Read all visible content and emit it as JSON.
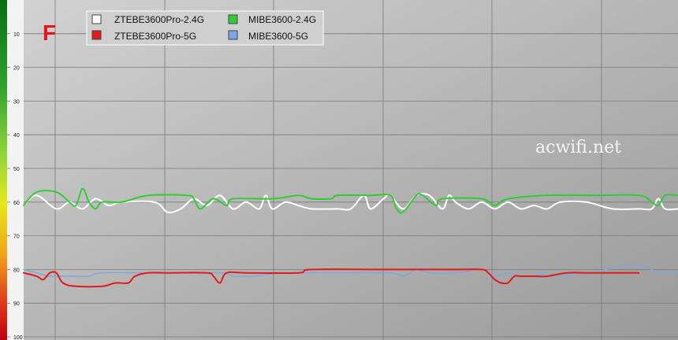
{
  "chart_data": {
    "type": "line",
    "grade_label": "F",
    "watermark": "acwifi.net",
    "y_axis": {
      "min": 0,
      "max": 100,
      "inverted": true,
      "ticks": [
        10,
        20,
        30,
        40,
        50,
        60,
        70,
        80,
        90,
        100
      ],
      "tick_labels": [
        "10",
        "20",
        "30",
        "40",
        "50",
        "60",
        "70",
        "80",
        "90",
        "100"
      ]
    },
    "x_axis": {
      "min": 0,
      "max": 100
    },
    "grid": true,
    "legend_position": "top-left",
    "series": [
      {
        "name": "ZTEBE3600Pro-2.4G",
        "color": "#ffffff",
        "points": [
          [
            0,
            61
          ],
          [
            2,
            58
          ],
          [
            5,
            62
          ],
          [
            7,
            60
          ],
          [
            9,
            62
          ],
          [
            11,
            59
          ],
          [
            13,
            61
          ],
          [
            15,
            60
          ],
          [
            20,
            60
          ],
          [
            22,
            63
          ],
          [
            24,
            62
          ],
          [
            26,
            59
          ],
          [
            28,
            61
          ],
          [
            30,
            58
          ],
          [
            32,
            62
          ],
          [
            34,
            60
          ],
          [
            36,
            62
          ],
          [
            37,
            58
          ],
          [
            38,
            62
          ],
          [
            40,
            60
          ],
          [
            42,
            61
          ],
          [
            44,
            62
          ],
          [
            48,
            62
          ],
          [
            50,
            62
          ],
          [
            52,
            58
          ],
          [
            53,
            62
          ],
          [
            55,
            59
          ],
          [
            56,
            58
          ],
          [
            58,
            62
          ],
          [
            60,
            58
          ],
          [
            62,
            58
          ],
          [
            64,
            62
          ],
          [
            65,
            58
          ],
          [
            66,
            60
          ],
          [
            68,
            62
          ],
          [
            70,
            60
          ],
          [
            72,
            62
          ],
          [
            74,
            60
          ],
          [
            76,
            62
          ],
          [
            78,
            61
          ],
          [
            80,
            62
          ],
          [
            82,
            60
          ],
          [
            86,
            60
          ],
          [
            90,
            62
          ],
          [
            94,
            62
          ],
          [
            96,
            62
          ],
          [
            97,
            59
          ],
          [
            98,
            62
          ],
          [
            100,
            62
          ]
        ]
      },
      {
        "name": "MIBE3600-2.4G",
        "color": "#33cc33",
        "points": [
          [
            0,
            61
          ],
          [
            2,
            57
          ],
          [
            5,
            57
          ],
          [
            7,
            60
          ],
          [
            8,
            61
          ],
          [
            9,
            56
          ],
          [
            10,
            60
          ],
          [
            11,
            62
          ],
          [
            12,
            60
          ],
          [
            15,
            60
          ],
          [
            19,
            58
          ],
          [
            25,
            58
          ],
          [
            26,
            59
          ],
          [
            27,
            62
          ],
          [
            29,
            59
          ],
          [
            31,
            61
          ],
          [
            32,
            59
          ],
          [
            38,
            59
          ],
          [
            42,
            58
          ],
          [
            44,
            59
          ],
          [
            47,
            59
          ],
          [
            48,
            58
          ],
          [
            53,
            58
          ],
          [
            56,
            58
          ],
          [
            57,
            62
          ],
          [
            58,
            63
          ],
          [
            60,
            58
          ],
          [
            61,
            58
          ],
          [
            63,
            61
          ],
          [
            64,
            59
          ],
          [
            70,
            59
          ],
          [
            72,
            61
          ],
          [
            74,
            59
          ],
          [
            80,
            58
          ],
          [
            87,
            58
          ],
          [
            94,
            58
          ],
          [
            96,
            60
          ],
          [
            97,
            61
          ],
          [
            98,
            58
          ],
          [
            100,
            58
          ]
        ]
      },
      {
        "name": "ZTEBE3600Pro-5G",
        "color": "#e31a1a",
        "points": [
          [
            0,
            81
          ],
          [
            2,
            82
          ],
          [
            3,
            83
          ],
          [
            4,
            81
          ],
          [
            5,
            81
          ],
          [
            6,
            84
          ],
          [
            8,
            85
          ],
          [
            12,
            85
          ],
          [
            14,
            84
          ],
          [
            16,
            84
          ],
          [
            17,
            82
          ],
          [
            19,
            81
          ],
          [
            22,
            81
          ],
          [
            28,
            81
          ],
          [
            29,
            82
          ],
          [
            30,
            84
          ],
          [
            31,
            81
          ],
          [
            34,
            81
          ],
          [
            42,
            81
          ],
          [
            44,
            80
          ],
          [
            55,
            80
          ],
          [
            62,
            80
          ],
          [
            66,
            80
          ],
          [
            70,
            80
          ],
          [
            71,
            81
          ],
          [
            72,
            83
          ],
          [
            73,
            84
          ],
          [
            74,
            84
          ],
          [
            75,
            82
          ],
          [
            76,
            82
          ],
          [
            78,
            82
          ],
          [
            80,
            82
          ],
          [
            83,
            81
          ],
          [
            86,
            81
          ],
          [
            90,
            81
          ],
          [
            94,
            81
          ]
        ]
      },
      {
        "name": "MIBE3600-5G",
        "color": "#7ea6e0",
        "points": [
          [
            0,
            80
          ],
          [
            2,
            81
          ],
          [
            4,
            82
          ],
          [
            6,
            82
          ],
          [
            8,
            82
          ],
          [
            10,
            82
          ],
          [
            12,
            81
          ],
          [
            20,
            81
          ],
          [
            30,
            81
          ],
          [
            32,
            82
          ],
          [
            35,
            82
          ],
          [
            40,
            81
          ],
          [
            48,
            81
          ],
          [
            56,
            81
          ],
          [
            58,
            82
          ],
          [
            60,
            80
          ],
          [
            62,
            81
          ],
          [
            66,
            81
          ],
          [
            70,
            80
          ],
          [
            72,
            82
          ],
          [
            74,
            81
          ],
          [
            76,
            82
          ],
          [
            78,
            82
          ],
          [
            80,
            81
          ],
          [
            82,
            82
          ],
          [
            85,
            81
          ],
          [
            87,
            81
          ],
          [
            89,
            80
          ],
          [
            91,
            79
          ],
          [
            94,
            79
          ],
          [
            96,
            80
          ],
          [
            97,
            81
          ],
          [
            100,
            81
          ]
        ]
      }
    ]
  }
}
